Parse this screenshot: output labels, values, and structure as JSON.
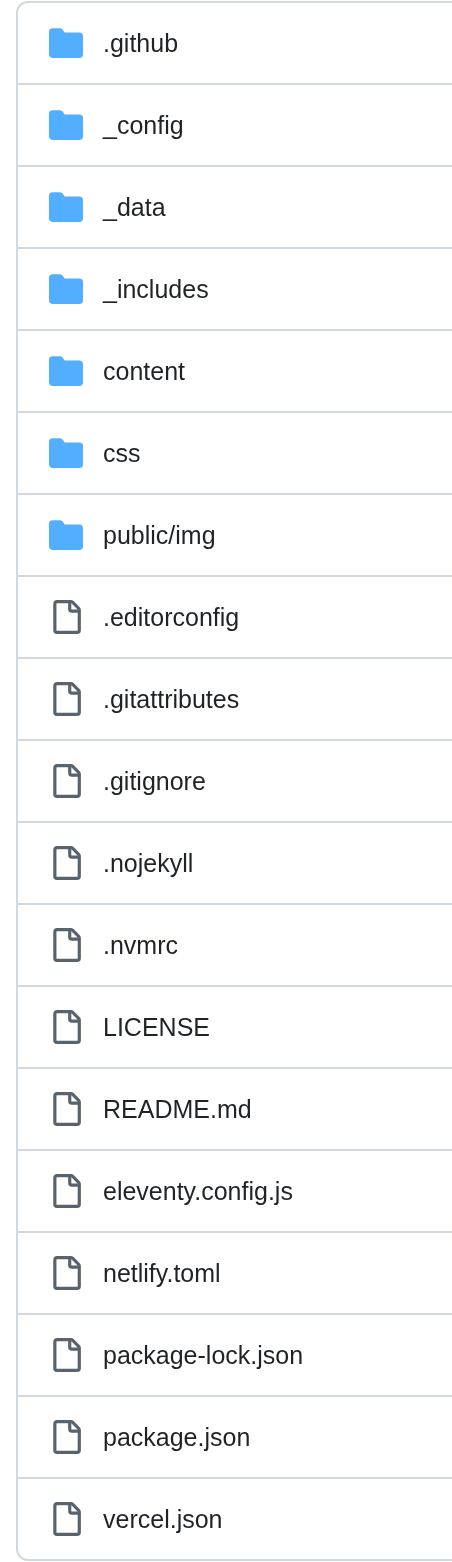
{
  "files": [
    {
      "name": ".github",
      "kind": "folder"
    },
    {
      "name": "_config",
      "kind": "folder"
    },
    {
      "name": "_data",
      "kind": "folder"
    },
    {
      "name": "_includes",
      "kind": "folder"
    },
    {
      "name": "content",
      "kind": "folder"
    },
    {
      "name": "css",
      "kind": "folder"
    },
    {
      "name": "public/img",
      "kind": "folder"
    },
    {
      "name": ".editorconfig",
      "kind": "file"
    },
    {
      "name": ".gitattributes",
      "kind": "file"
    },
    {
      "name": ".gitignore",
      "kind": "file"
    },
    {
      "name": ".nojekyll",
      "kind": "file"
    },
    {
      "name": ".nvmrc",
      "kind": "file"
    },
    {
      "name": "LICENSE",
      "kind": "file"
    },
    {
      "name": "README.md",
      "kind": "file"
    },
    {
      "name": "eleventy.config.js",
      "kind": "file"
    },
    {
      "name": "netlify.toml",
      "kind": "file"
    },
    {
      "name": "package-lock.json",
      "kind": "file"
    },
    {
      "name": "package.json",
      "kind": "file"
    },
    {
      "name": "vercel.json",
      "kind": "file"
    }
  ]
}
